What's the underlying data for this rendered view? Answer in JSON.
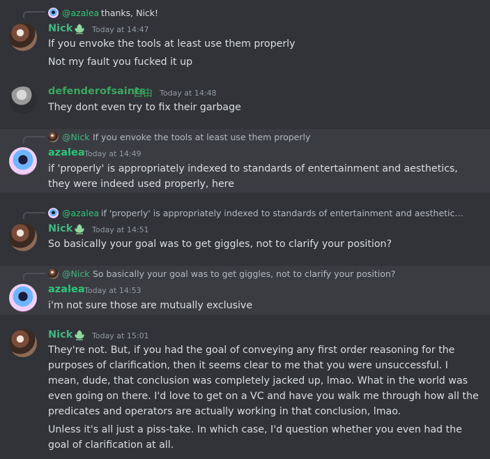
{
  "messages": [
    {
      "reply": {
        "name": "@azalea",
        "text": "thanks, Nick!"
      },
      "author": "Nick",
      "badge": "leaf-badge",
      "timestamp": "Today at 14:47",
      "lines": [
        "If you envoke the tools at least use them properly",
        "Not my fault you fucked it up"
      ]
    },
    {
      "author": "defenderofsaints",
      "badge": "自由",
      "timestamp": "Today at 14:48",
      "lines": [
        "They dont even try to fix their garbage"
      ]
    },
    {
      "reply": {
        "name": "@Nick",
        "text": "If you envoke the tools at least use them properly"
      },
      "author": "azalea",
      "timestamp": "Today at 14:49",
      "lines": [
        "if 'properly' is appropriately indexed to standards of entertainment and aesthetics,",
        "they were indeed used properly, here"
      ]
    },
    {
      "reply": {
        "name": "@azalea",
        "text": "if 'properly' is appropriately indexed to standards of entertainment and aesthetics, th..."
      },
      "author": "Nick",
      "badge": "leaf-badge",
      "timestamp": "Today at 14:51",
      "lines": [
        "So basically your goal was to get giggles, not to clarify your position?"
      ]
    },
    {
      "reply": {
        "name": "@Nick",
        "text": "So basically your goal was to get giggles, not to clarify your position?"
      },
      "author": "azalea",
      "timestamp": "Today at 14:53",
      "lines": [
        "i'm not sure those are mutually exclusive"
      ]
    },
    {
      "author": "Nick",
      "badge": "leaf-badge",
      "timestamp": "Today at 15:01",
      "lines": [
        "They're not. But, if you had the goal of conveying any first order reasoning for the",
        "purposes of clarification, then it seems clear to me that you were unsuccessful. I",
        "mean, dude, that conclusion was completely jacked up, lmao. What in the world was",
        "even going on there. I'd love to get on a VC and have you walk me through how all the",
        "predicates and operators are actually working in that conclusion, lmao.",
        "Unless it's all just a piss-take. In which case, I'd question whether you even had the",
        "goal of clarification at all."
      ]
    }
  ],
  "colors": {
    "background": "#313338",
    "highlight": "#3a3c42",
    "nick": "#43b581",
    "defender": "#3ba55d",
    "azalea": "#2dc77a"
  }
}
